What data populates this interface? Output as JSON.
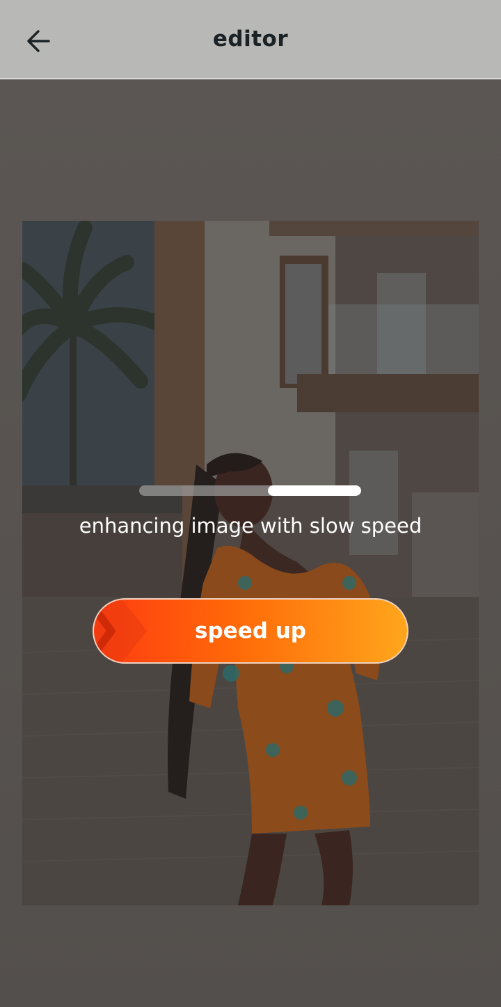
{
  "header": {
    "title": "editor",
    "back_icon": "arrow-left-icon"
  },
  "loading": {
    "progress_fraction": 0.42,
    "status_text": "enhancing image with slow speed"
  },
  "speed_up_button": {
    "label": "speed up",
    "icon": "double-chevron-right-icon"
  },
  "colors": {
    "header_bg": "#b8b9b6",
    "title_color": "#1b2226",
    "button_gradient_start": "#ff3b12",
    "button_gradient_end": "#ffa61c"
  }
}
